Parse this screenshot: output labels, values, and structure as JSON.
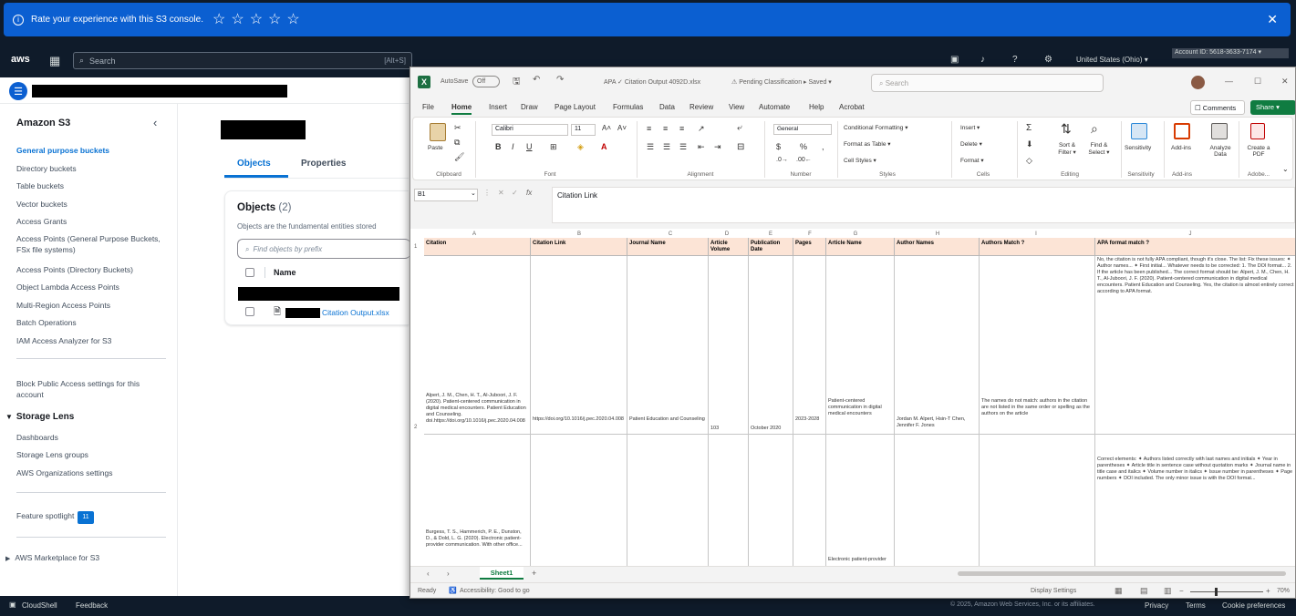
{
  "banner": {
    "text": "Rate your experience with this S3 console.",
    "stars": [
      "☆",
      "☆",
      "☆",
      "☆",
      "☆"
    ],
    "close": "✕"
  },
  "topnav": {
    "logo": "aws",
    "search_placeholder": "Search",
    "search_shortcut": "[Alt+S]",
    "region": "United States (Ohio) ▾",
    "account": "Account ID: 5618-3633-7174 ▾"
  },
  "sidenav": {
    "title": "Amazon S3",
    "items": [
      "General purpose buckets",
      "Directory buckets",
      "Table buckets",
      "Vector buckets",
      "Access Grants",
      "Access Points (General Purpose Buckets, FSx file systems)",
      "Access Points (Directory Buckets)",
      "Object Lambda Access Points",
      "Multi-Region Access Points",
      "Batch Operations",
      "IAM Access Analyzer for S3"
    ],
    "block_public": "Block Public Access settings for this account",
    "storage_lens": "Storage Lens",
    "storage_lens_items": [
      "Dashboards",
      "Storage Lens groups",
      "AWS Organizations settings"
    ],
    "feature_spotlight": "Feature spotlight",
    "feature_badge": "11",
    "marketplace": "AWS Marketplace for S3"
  },
  "main": {
    "tabs": [
      "Objects",
      "Properties"
    ],
    "objects_title": "Objects",
    "objects_count": "(2)",
    "objects_desc": "Objects are the fundamental entities stored",
    "find_placeholder": "Find objects by prefix",
    "col_name": "Name",
    "file_name": "Citation Output.xlsx"
  },
  "footer": {
    "cloudshell": "CloudShell",
    "feedback": "Feedback",
    "copyright": "© 2025, Amazon Web Services, Inc. or its affiliates.",
    "privacy": "Privacy",
    "terms": "Terms",
    "cookie": "Cookie preferences"
  },
  "excel": {
    "autosave": "AutoSave",
    "autosave_state": "Off",
    "filename": "APA ✓ Citation Output 4092D.xlsx",
    "classification": "⚠ Pending Classification ▸ Saved ▾",
    "search": "Search",
    "menu": [
      "File",
      "Home",
      "Insert",
      "Draw",
      "Page Layout",
      "Formulas",
      "Data",
      "Review",
      "View",
      "Automate",
      "Help",
      "Acrobat"
    ],
    "comments": "☐ Comments",
    "share": "Share ▾",
    "ribbon": {
      "paste": "Paste",
      "font_name": "Calibri",
      "font_size": "11",
      "number_format": "General",
      "conditional": "Conditional Formatting ▾",
      "format_table": "Format as Table ▾",
      "cell_styles": "Cell Styles ▾",
      "insert": "Insert ▾",
      "delete": "Delete ▾",
      "format": "Format ▾",
      "sort_filter": "Sort & Filter ▾",
      "find_select": "Find & Select ▾",
      "sensitivity": "Sensitivity",
      "addins": "Add-ins",
      "analyze": "Analyze Data",
      "create_pdf": "Create a PDF",
      "groups": [
        "Clipboard",
        "Font",
        "Alignment",
        "Number",
        "Styles",
        "Cells",
        "Editing",
        "Sensitivity",
        "Add-ins",
        "Adobe..."
      ]
    },
    "namebox": "B1",
    "fx": "fx",
    "formula_content": "Citation Link",
    "col_letters": [
      "A",
      "B",
      "C",
      "D",
      "E",
      "F",
      "G",
      "H",
      "I",
      "J"
    ],
    "headers": [
      "Citation",
      "Citation Link",
      "Journal Name",
      "Article Volume",
      "Publication Date",
      "Pages",
      "Article Name",
      "Author Names",
      "Authors Match ?",
      "APA format match ?"
    ],
    "row2": {
      "citation": "Alpert, J. M., Chen, H. T., Al-Juboori, J. F. (2020). Patient-centered communication in digital medical encounters. Patient Education and Counseling. doi.https://doi.org/10.1016/j.pec.2020.04.008",
      "link": "https://doi.org/10.1016/j.pec.2020.04.008",
      "journal": "Patient Education and Counseling",
      "volume": "103",
      "date": "October 2020",
      "pages": "2023-2028",
      "article": "Patient-centered communication in digital medical encounters",
      "authors": "Jordan M. Alpert, Hsin-T Chen, Jennifer F. Jones",
      "match": "The names do not match: authors in the citation are not listed in the same order or spelling as the authors on the article",
      "apa": "No, the citation is not fully APA compliant, though it's close. The list: Fix these issues: ✦ Author names... ✦ First initial... Whatever needs to be corrected: 1. The DOI format... 2. If the article has been published... The correct format should be: Alpert, J. M., Chen, H. T., Al-Juboori, J. F. (2020). Patient-centered communication in digital medical encounters. Patient Education and Counseling. Yes, the citation is almost entirely correct according to APA format."
    },
    "row3": {
      "citation": "Burgess, T. S., Hammerich, P. E., Dunston, D., & Dold, L. G. (2020). Electronic patient-provider communication. With other office...",
      "article": "Electronic patient-provider",
      "apa": "Correct elements: ✦ Authors listed correctly with last names and initials ✦ Year in parentheses ✦ Article title in sentence case without quotation marks ✦ Journal name in title case and italics ✦ Volume number in italics ✦ Issue number in parentheses ✦ Page numbers ✦ DOI included. The only minor issue is with the DOI format..."
    },
    "sheet_name": "Sheet1",
    "status_ready": "Ready",
    "accessibility": "Accessibility: Good to go",
    "display_settings": "Display Settings",
    "zoom": "70%"
  }
}
